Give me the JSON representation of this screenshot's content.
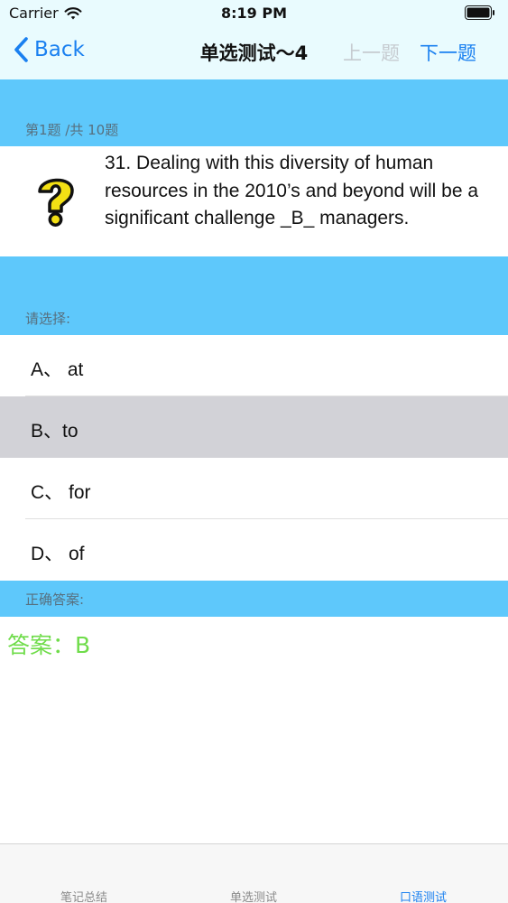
{
  "status_bar": {
    "carrier": "Carrier",
    "time": "8:19 PM"
  },
  "nav": {
    "back_label": "Back",
    "title": "单选测试～4",
    "prev_label": "上一题",
    "next_label": "下一题"
  },
  "question_header": "第1题 /共 10题",
  "question": {
    "text": "31. Dealing with this diversity of human resources in the 2010’s and beyond will be a significant challenge _B_ managers.",
    "icon": "question-mark-icon"
  },
  "choose_label": "请选择:",
  "options": [
    {
      "label": "A、 at",
      "selected": false
    },
    {
      "label": "B、to",
      "selected": true
    },
    {
      "label": "C、 for",
      "selected": false
    },
    {
      "label": "D、 of",
      "selected": false
    }
  ],
  "correct_answer_label": "正确答案:",
  "answer_text": "答案：B",
  "tabs": [
    {
      "label": "笔记总结",
      "active": false
    },
    {
      "label": "单选测试",
      "active": false
    },
    {
      "label": "口语测试",
      "active": true
    }
  ],
  "colors": {
    "accent": "#1a80f0",
    "band": "#5ec8fb",
    "header_bg": "#e9fbfe",
    "selected_row": "#d2d2d7",
    "answer": "#6fdc4a",
    "disabled": "#c6cbd0"
  }
}
